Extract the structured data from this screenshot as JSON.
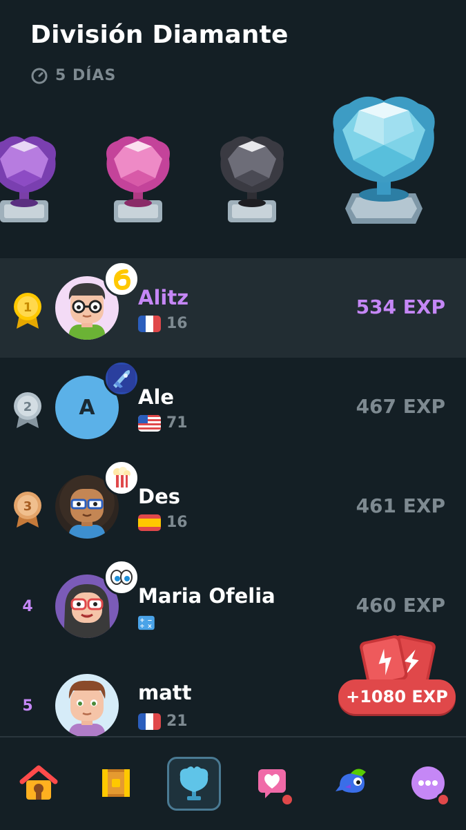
{
  "header": {
    "title": "División Diamante",
    "timer": "5 DÍAS"
  },
  "colors": {
    "background": "#141f25",
    "highlight_row": "#222d33",
    "accent_purple": "#c587f6",
    "muted": "#7e8a91",
    "promo_red": "#e0484a"
  },
  "trophies": [
    {
      "name": "amethyst-trophy-icon",
      "color": "#9d4fd0"
    },
    {
      "name": "pearl-trophy-icon",
      "color": "#d84ca4"
    },
    {
      "name": "obsidian-trophy-icon",
      "color": "#4a4a52"
    },
    {
      "name": "diamond-trophy-icon",
      "color": "#4fb8d8"
    }
  ],
  "leaderboard": [
    {
      "rank": "1",
      "name": "Alitz",
      "flag": "flag-france-icon",
      "level": "16",
      "xp": "534 EXP",
      "is_me": true,
      "badge": "streak-6-icon"
    },
    {
      "rank": "2",
      "name": "Ale",
      "flag": "flag-usa-icon",
      "level": "71",
      "xp": "467 EXP",
      "badge": "rocket-icon",
      "avatar_letter": "A"
    },
    {
      "rank": "3",
      "name": "Des",
      "flag": "flag-spain-icon",
      "level": "16",
      "xp": "461 EXP",
      "badge": "popcorn-icon"
    },
    {
      "rank": "4",
      "name": "Maria Ofelia",
      "flag": "math-icon",
      "level": "",
      "xp": "460 EXP",
      "badge": "eyes-icon"
    },
    {
      "rank": "5",
      "name": "matt",
      "flag": "flag-france-icon",
      "level": "21",
      "xp": "",
      "badge": ""
    }
  ],
  "promo": {
    "label": "+1080 EXP",
    "icon": "xp-boost-cards-icon"
  },
  "nav": [
    {
      "name": "home-icon"
    },
    {
      "name": "chest-icon"
    },
    {
      "name": "leagues-icon",
      "active": true
    },
    {
      "name": "heart-icon",
      "notification": true
    },
    {
      "name": "bird-icon"
    },
    {
      "name": "more-icon",
      "notification": true
    }
  ]
}
